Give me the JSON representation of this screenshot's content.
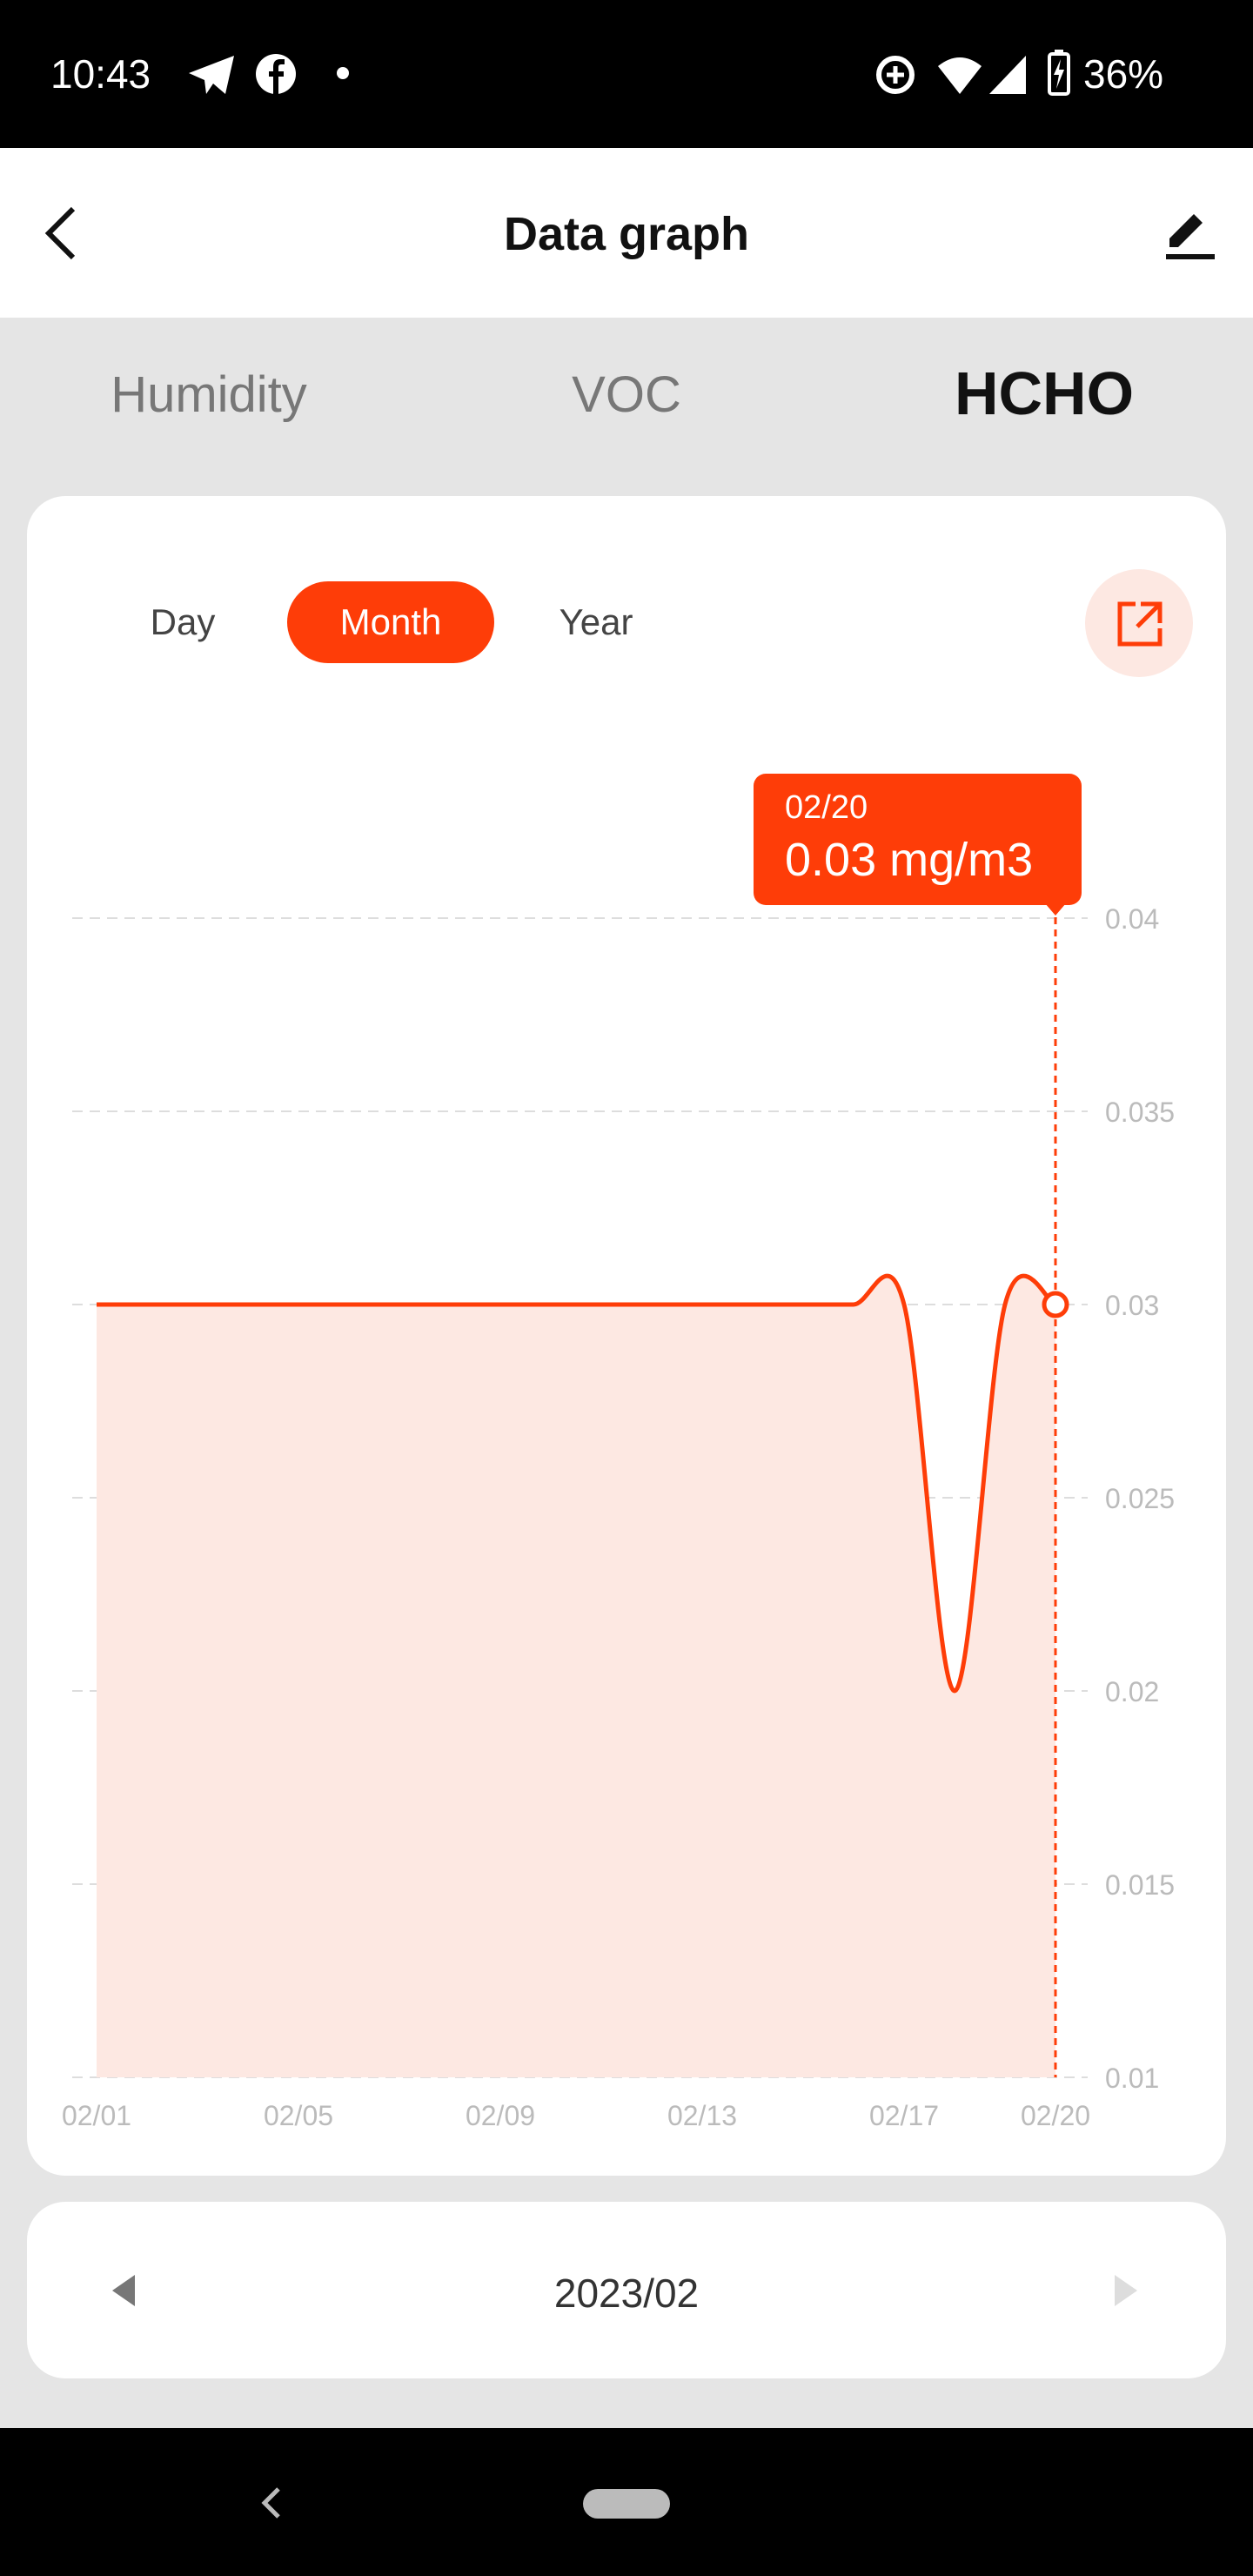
{
  "status_bar": {
    "time": "10:43",
    "battery": "36%",
    "icons": [
      "telegram-icon",
      "facebook-icon",
      "dot-icon",
      "data-saver-icon",
      "wifi-icon",
      "signal-icon",
      "battery-charging-icon"
    ]
  },
  "header": {
    "title": "Data graph",
    "back_icon": "back-arrow-icon",
    "edit_icon": "edit-icon"
  },
  "tabs": [
    {
      "label": "Humidity",
      "active": false
    },
    {
      "label": "VOC",
      "active": false
    },
    {
      "label": "HCHO",
      "active": true
    }
  ],
  "ranges": [
    {
      "label": "Day",
      "active": false
    },
    {
      "label": "Month",
      "active": true
    },
    {
      "label": "Year",
      "active": false
    }
  ],
  "accent": "#fe3d08",
  "tooltip": {
    "date": "02/20",
    "value": "0.03 mg/m3"
  },
  "chart_data": {
    "type": "area",
    "x": [
      "02/01",
      "02/02",
      "02/03",
      "02/04",
      "02/05",
      "02/06",
      "02/07",
      "02/08",
      "02/09",
      "02/10",
      "02/11",
      "02/12",
      "02/13",
      "02/14",
      "02/15",
      "02/16",
      "02/17",
      "02/18",
      "02/19",
      "02/20"
    ],
    "values": [
      0.03,
      0.03,
      0.03,
      0.03,
      0.03,
      0.03,
      0.03,
      0.03,
      0.03,
      0.03,
      0.03,
      0.03,
      0.03,
      0.03,
      0.03,
      0.03,
      0.03,
      0.02,
      0.03,
      0.03
    ],
    "x_tick_labels": [
      "02/01",
      "02/05",
      "02/09",
      "02/13",
      "02/17",
      "02/20"
    ],
    "y_tick_labels": [
      "0.04",
      "0.035",
      "0.03",
      "0.025",
      "0.02",
      "0.015",
      "0.01"
    ],
    "ylim": [
      0.01,
      0.04
    ],
    "grid": true,
    "color": "#fe3d08",
    "fill": "#fde8e2",
    "selected": "02/20"
  },
  "footer": {
    "period": "2023/02",
    "prev_icon": "triangle-left-icon",
    "next_icon": "triangle-right-icon"
  }
}
